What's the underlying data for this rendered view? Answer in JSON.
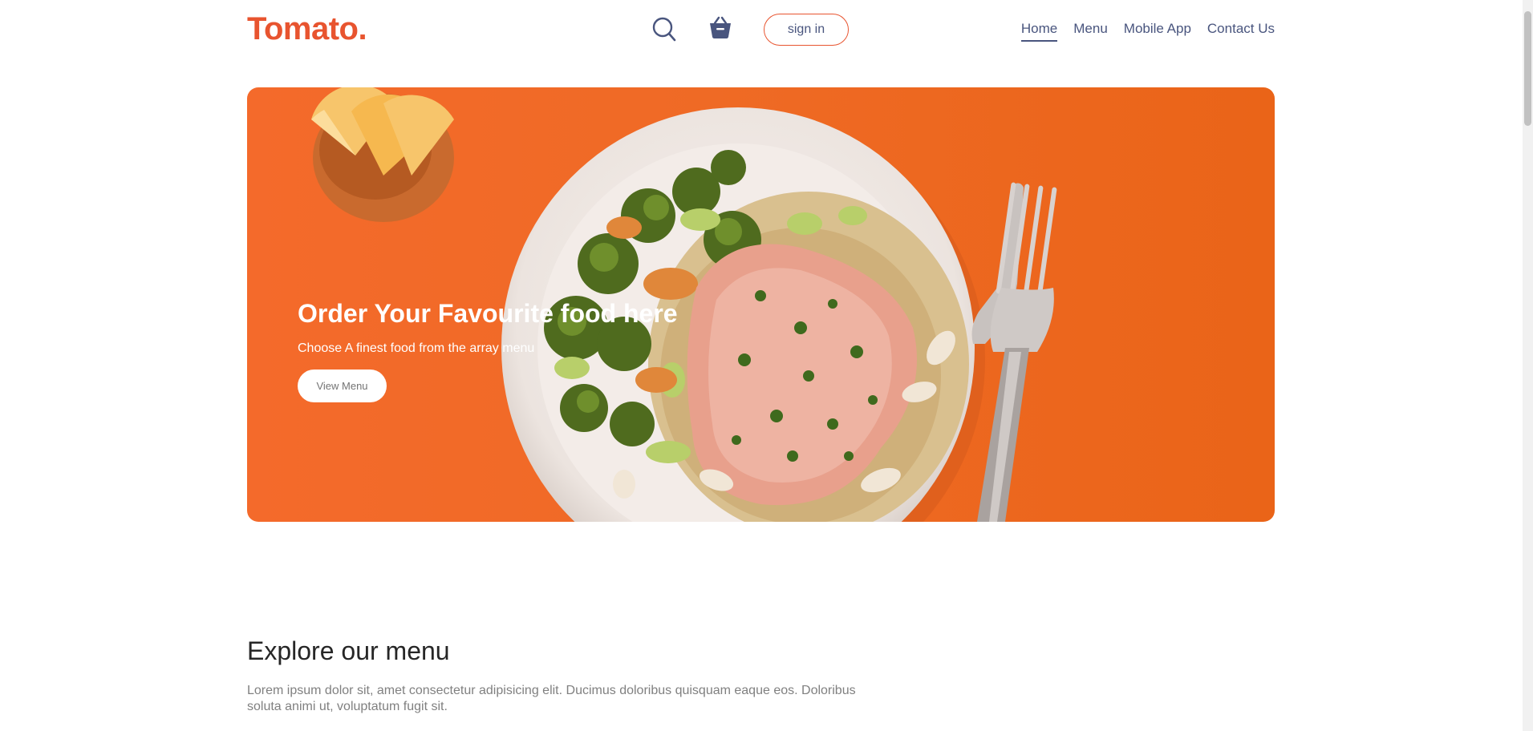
{
  "navbar": {
    "logo": "Tomato.",
    "search_icon": "search-icon",
    "basket_icon": "basket-icon",
    "signin_label": "sign in",
    "links": [
      {
        "label": "Home",
        "active": true
      },
      {
        "label": "Menu",
        "active": false
      },
      {
        "label": "Mobile App",
        "active": false
      },
      {
        "label": "Contact Us",
        "active": false
      }
    ]
  },
  "hero": {
    "title": "Order Your Favourite food here",
    "subtitle": "Choose A finest food from the array menu",
    "button_label": "View Menu"
  },
  "explore": {
    "title": "Explore our menu",
    "text": "Lorem ipsum dolor sit, amet consectetur adipisicing elit. Ducimus doloribus quisquam eaque eos. Doloribus soluta animi ut, voluptatum fugit sit."
  },
  "colors": {
    "brand": "#e8542f",
    "nav_text": "#49557e",
    "hero_bg": "#ef6a25"
  }
}
